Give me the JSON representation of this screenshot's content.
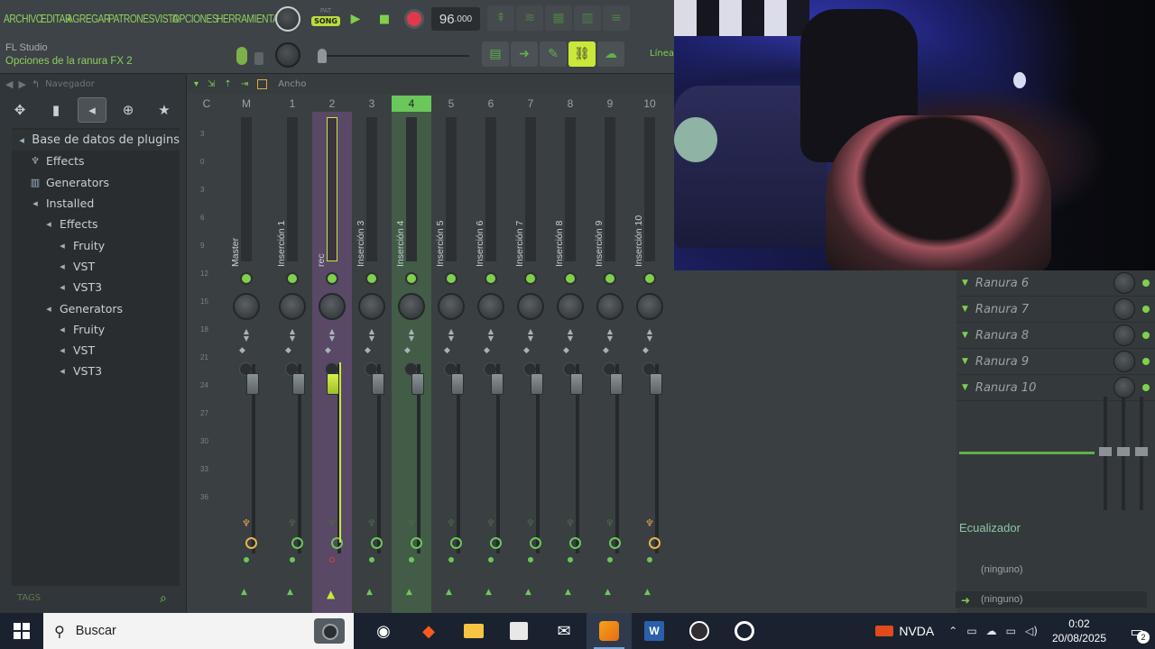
{
  "menu": [
    "ARCHIVO",
    "EDITAR",
    "AGREGAR",
    "PATRONES",
    "VISTA",
    "OPCIONES",
    "HERRAMIENTAS"
  ],
  "hint": {
    "title": "FL Studio",
    "text": "Opciones de la ranura FX 2"
  },
  "transport": {
    "pat_label": "PAT",
    "song_label": "SONG",
    "tempo_main": "96",
    "tempo_frac": ".000"
  },
  "browser": {
    "nav_label": "Navegador",
    "tree": [
      {
        "label": "Base de datos de plugins",
        "level": 0,
        "icon": "plug"
      },
      {
        "label": "Effects",
        "level": 1,
        "icon": "bulb"
      },
      {
        "label": "Generators",
        "level": 1,
        "icon": "bars"
      },
      {
        "label": "Installed",
        "level": 1,
        "icon": "plug"
      },
      {
        "label": "Effects",
        "level": 2,
        "icon": "plug"
      },
      {
        "label": "Fruity",
        "level": 3,
        "icon": "plug"
      },
      {
        "label": "VST",
        "level": 3,
        "icon": "plug"
      },
      {
        "label": "VST3",
        "level": 3,
        "icon": "plug"
      },
      {
        "label": "Generators",
        "level": 2,
        "icon": "plug"
      },
      {
        "label": "Fruity",
        "level": 3,
        "icon": "plug"
      },
      {
        "label": "VST",
        "level": 3,
        "icon": "plug"
      },
      {
        "label": "VST3",
        "level": 3,
        "icon": "plug"
      }
    ],
    "tags_label": "TAGS"
  },
  "mixer": {
    "width_label": "Ancho",
    "linea_label": "Línea",
    "scale": [
      "3",
      "0",
      "3",
      "6",
      "9",
      "12",
      "15",
      "18",
      "21",
      "24",
      "27",
      "30",
      "33",
      "36"
    ],
    "strips": [
      {
        "num": "C",
        "name": ""
      },
      {
        "num": "M",
        "name": "Master"
      },
      {
        "num": "1",
        "name": "Inserción 1"
      },
      {
        "num": "2",
        "name": "rec"
      },
      {
        "num": "3",
        "name": "Inserción 3"
      },
      {
        "num": "4",
        "name": "Inserción 4"
      },
      {
        "num": "5",
        "name": "Inserción 5"
      },
      {
        "num": "6",
        "name": "Inserción 6"
      },
      {
        "num": "7",
        "name": "Inserción 7"
      },
      {
        "num": "8",
        "name": "Inserción 8"
      },
      {
        "num": "9",
        "name": "Inserción 9"
      },
      {
        "num": "10",
        "name": "Inserción 10"
      }
    ],
    "slots": [
      "Ranura 6",
      "Ranura 7",
      "Ranura 8",
      "Ranura 9",
      "Ranura 10"
    ],
    "eq_label": "Ecualizador",
    "input_label": "(ninguno)",
    "output_label": "(ninguno)"
  },
  "taskbar": {
    "search_placeholder": "Buscar",
    "nvda_label": "NVDA",
    "time": "0:02",
    "date": "20/08/2025",
    "notification_count": "2"
  }
}
